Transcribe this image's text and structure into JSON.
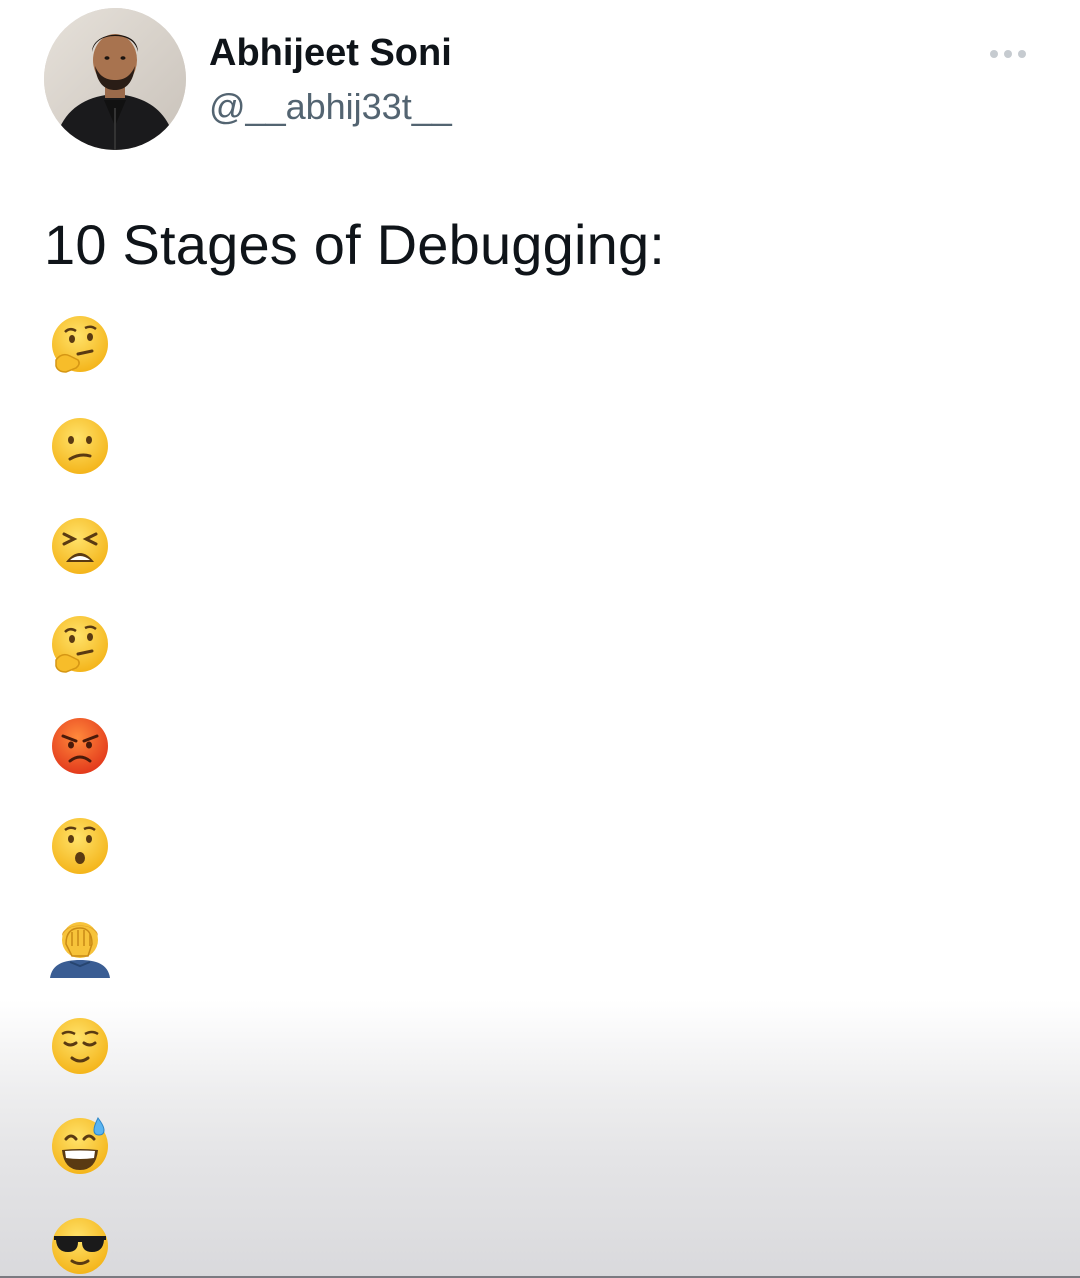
{
  "tweet": {
    "author_name": "Abhijeet Soni",
    "author_handle": "@__abhij33t__",
    "text": "10 Stages of Debugging:",
    "emojis": [
      "thinking-face-icon",
      "confused-face-icon",
      "tired-face-icon",
      "thinking-face-icon",
      "pouting-face-icon",
      "hushed-face-icon",
      "facepalm-icon",
      "relieved-face-icon",
      "grinning-sweat-face-icon",
      "sunglasses-face-icon"
    ]
  },
  "colors": {
    "text_primary": "#0f1419",
    "text_secondary": "#536471",
    "emoji_yellow": "#f9c72f",
    "emoji_red": "#f1561c"
  },
  "icons": {
    "avatar": "avatar",
    "more": "more-options-icon"
  }
}
